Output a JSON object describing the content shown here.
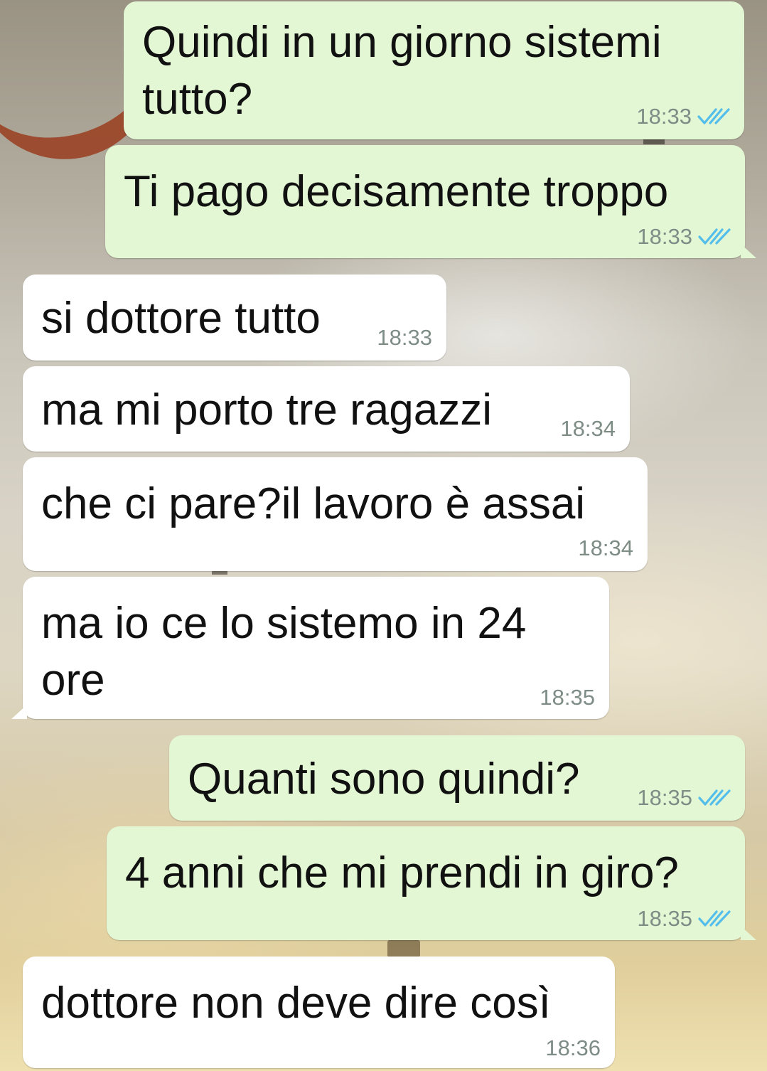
{
  "chat": {
    "messages": [
      {
        "direction": "outgoing",
        "lines": [
          "Quindi in un giorno sistemi",
          "tutto?"
        ],
        "time": "18:33",
        "status_icon": "double-check-icon"
      },
      {
        "direction": "outgoing",
        "lines": [
          "Ti pago decisamente troppo"
        ],
        "time": "18:33",
        "status_icon": "double-check-icon"
      },
      {
        "direction": "incoming",
        "lines": [
          "si dottore tutto"
        ],
        "time": "18:33"
      },
      {
        "direction": "incoming",
        "lines": [
          "ma mi porto tre ragazzi"
        ],
        "time": "18:34"
      },
      {
        "direction": "incoming",
        "lines": [
          "che ci pare?il lavoro è assai"
        ],
        "time": "18:34"
      },
      {
        "direction": "incoming",
        "lines": [
          "ma io ce lo sistemo in 24",
          "ore"
        ],
        "time": "18:35"
      },
      {
        "direction": "outgoing",
        "lines": [
          "Quanti sono quindi?"
        ],
        "time": "18:35",
        "status_icon": "double-check-icon"
      },
      {
        "direction": "outgoing",
        "lines": [
          "4 anni che mi prendi in giro?"
        ],
        "time": "18:35",
        "status_icon": "double-check-icon"
      },
      {
        "direction": "incoming",
        "lines": [
          "dottore non deve dire così"
        ],
        "time": "18:36"
      }
    ]
  },
  "colors": {
    "outgoing_bubble": "#e3f7d4",
    "incoming_bubble": "#ffffff",
    "read_ticks": "#53bdeb",
    "timestamp": "#7e8c86"
  }
}
